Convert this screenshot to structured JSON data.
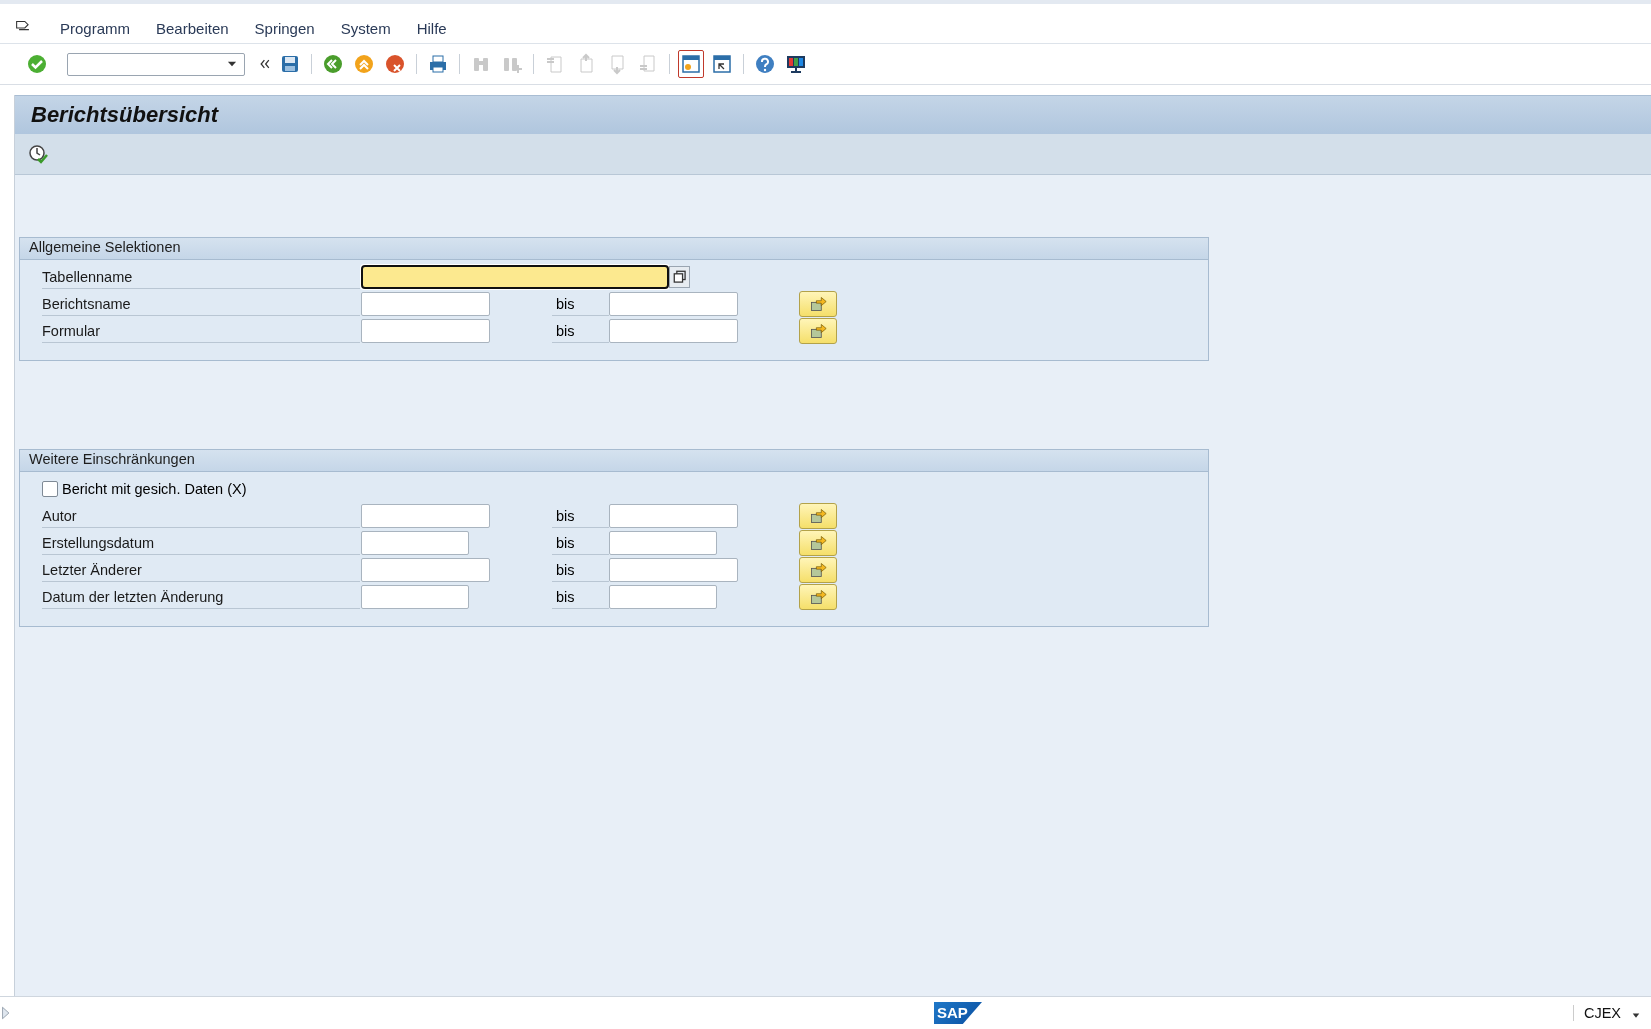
{
  "menu": [
    {
      "label": "Programm"
    },
    {
      "label": "Bearbeiten"
    },
    {
      "label": "Springen"
    },
    {
      "label": "System"
    },
    {
      "label": "Hilfe"
    }
  ],
  "toolbar_buttons": [
    {
      "disabled": false,
      "selected": false
    },
    {
      "disabled": false,
      "selected": false
    },
    {
      "disabled": false,
      "selected": false
    },
    {
      "disabled": false,
      "selected": false
    },
    {
      "disabled": false,
      "selected": false
    },
    {
      "disabled": false,
      "selected": false
    },
    {
      "disabled": true,
      "selected": false
    },
    {
      "disabled": true,
      "selected": false
    },
    {
      "disabled": true,
      "selected": false
    },
    {
      "disabled": true,
      "selected": false
    },
    {
      "disabled": true,
      "selected": false
    },
    {
      "disabled": true,
      "selected": false
    },
    {
      "disabled": false,
      "selected": true
    },
    {
      "disabled": false,
      "selected": false
    },
    {
      "disabled": false,
      "selected": false
    },
    {
      "disabled": false,
      "selected": false
    }
  ],
  "title": "Berichtsübersicht",
  "groups": [
    {
      "title": "Allgemeine Selektionen",
      "rows": [
        {
          "kind": "lookup",
          "label": "Tabellenname",
          "focused": true
        },
        {
          "kind": "text_range",
          "label": "Berichtsname",
          "to_label": "bis"
        },
        {
          "kind": "text_range",
          "label": "Formular",
          "to_label": "bis"
        }
      ]
    },
    {
      "title": "Weitere Einschränkungen",
      "rows": [
        {
          "kind": "checkbox",
          "label": "Bericht mit gesich. Daten (X)",
          "checked": false
        },
        {
          "kind": "text_range",
          "label": "Autor",
          "to_label": "bis"
        },
        {
          "kind": "date_range",
          "label": "Erstellungsdatum",
          "to_label": "bis"
        },
        {
          "kind": "text_range",
          "label": "Letzter Änderer",
          "to_label": "bis"
        },
        {
          "kind": "date_range",
          "label": "Datum der letzten Änderung",
          "to_label": "bis"
        }
      ]
    }
  ],
  "footer": {
    "logo": "SAP",
    "system": "CJEX"
  }
}
